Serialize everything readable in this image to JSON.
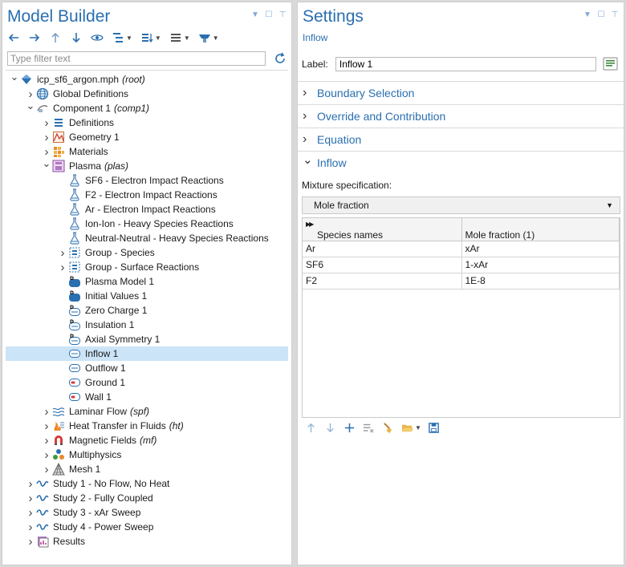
{
  "model_builder": {
    "title": "Model Builder",
    "filter_placeholder": "Type filter text",
    "tree": [
      {
        "depth": 0,
        "expand": "open",
        "icon": "model-icon",
        "label": "icp_sf6_argon.mph",
        "tag": "(root)"
      },
      {
        "depth": 1,
        "expand": "closed",
        "icon": "globe-icon",
        "label": "Global Definitions",
        "tag": ""
      },
      {
        "depth": 1,
        "expand": "open",
        "icon": "component-icon",
        "label": "Component 1",
        "tag": "(comp1)"
      },
      {
        "depth": 2,
        "expand": "closed",
        "icon": "definitions-icon",
        "label": "Definitions",
        "tag": ""
      },
      {
        "depth": 2,
        "expand": "closed",
        "icon": "geometry-icon",
        "label": "Geometry 1",
        "tag": ""
      },
      {
        "depth": 2,
        "expand": "closed",
        "icon": "materials-icon",
        "label": "Materials",
        "tag": ""
      },
      {
        "depth": 2,
        "expand": "open",
        "icon": "plasma-icon",
        "label": "Plasma",
        "tag": "(plas)"
      },
      {
        "depth": 3,
        "expand": "none",
        "icon": "reaction-icon",
        "label": "SF6 - Electron Impact Reactions",
        "tag": ""
      },
      {
        "depth": 3,
        "expand": "none",
        "icon": "reaction-icon",
        "label": "F2 - Electron Impact Reactions",
        "tag": ""
      },
      {
        "depth": 3,
        "expand": "none",
        "icon": "reaction-icon",
        "label": "Ar - Electron Impact Reactions",
        "tag": ""
      },
      {
        "depth": 3,
        "expand": "none",
        "icon": "reaction-icon",
        "label": "Ion-Ion - Heavy Species Reactions",
        "tag": ""
      },
      {
        "depth": 3,
        "expand": "none",
        "icon": "reaction-icon",
        "label": "Neutral-Neutral - Heavy Species Reactions",
        "tag": ""
      },
      {
        "depth": 3,
        "expand": "closed",
        "icon": "group-icon",
        "label": "Group - Species",
        "tag": ""
      },
      {
        "depth": 3,
        "expand": "closed",
        "icon": "group-icon",
        "label": "Group - Surface Reactions",
        "tag": ""
      },
      {
        "depth": 3,
        "expand": "none",
        "icon": "domain-node-icon",
        "label": "Plasma Model 1",
        "tag": ""
      },
      {
        "depth": 3,
        "expand": "none",
        "icon": "domain-node-icon",
        "label": "Initial Values 1",
        "tag": ""
      },
      {
        "depth": 3,
        "expand": "none",
        "icon": "boundary-default-icon",
        "label": "Zero Charge 1",
        "tag": ""
      },
      {
        "depth": 3,
        "expand": "none",
        "icon": "boundary-default-icon",
        "label": "Insulation 1",
        "tag": ""
      },
      {
        "depth": 3,
        "expand": "none",
        "icon": "boundary-default-icon",
        "label": "Axial Symmetry 1",
        "tag": ""
      },
      {
        "depth": 3,
        "expand": "none",
        "icon": "boundary-icon",
        "label": "Inflow 1",
        "tag": "",
        "selected": true
      },
      {
        "depth": 3,
        "expand": "none",
        "icon": "boundary-icon",
        "label": "Outflow 1",
        "tag": ""
      },
      {
        "depth": 3,
        "expand": "none",
        "icon": "boundary-red-icon",
        "label": "Ground 1",
        "tag": ""
      },
      {
        "depth": 3,
        "expand": "none",
        "icon": "boundary-red-icon",
        "label": "Wall 1",
        "tag": ""
      },
      {
        "depth": 2,
        "expand": "closed",
        "icon": "laminar-flow-icon",
        "label": "Laminar Flow",
        "tag": "(spf)"
      },
      {
        "depth": 2,
        "expand": "closed",
        "icon": "heat-transfer-icon",
        "label": "Heat Transfer in Fluids",
        "tag": "(ht)"
      },
      {
        "depth": 2,
        "expand": "closed",
        "icon": "magnet-icon",
        "label": "Magnetic Fields",
        "tag": "(mf)"
      },
      {
        "depth": 2,
        "expand": "closed",
        "icon": "multiphysics-icon",
        "label": "Multiphysics",
        "tag": ""
      },
      {
        "depth": 2,
        "expand": "closed",
        "icon": "mesh-icon",
        "label": "Mesh 1",
        "tag": ""
      },
      {
        "depth": 1,
        "expand": "closed",
        "icon": "study-icon",
        "label": "Study 1 - No Flow, No Heat",
        "tag": ""
      },
      {
        "depth": 1,
        "expand": "closed",
        "icon": "study-icon",
        "label": "Study 2 - Fully Coupled",
        "tag": ""
      },
      {
        "depth": 1,
        "expand": "closed",
        "icon": "study-icon",
        "label": "Study 3 - xAr Sweep",
        "tag": ""
      },
      {
        "depth": 1,
        "expand": "closed",
        "icon": "study-icon",
        "label": "Study 4 - Power Sweep",
        "tag": ""
      },
      {
        "depth": 1,
        "expand": "closed",
        "icon": "results-icon",
        "label": "Results",
        "tag": ""
      }
    ]
  },
  "settings": {
    "title": "Settings",
    "subtitle": "Inflow",
    "label_caption": "Label:",
    "label_value": "Inflow 1",
    "sections": [
      {
        "label": "Boundary Selection",
        "state": "collapsed"
      },
      {
        "label": "Override and Contribution",
        "state": "collapsed"
      },
      {
        "label": "Equation",
        "state": "collapsed"
      },
      {
        "label": "Inflow",
        "state": "expanded"
      }
    ],
    "mixture_label": "Mixture specification:",
    "mixture_value": "Mole fraction",
    "table": {
      "headers": [
        "Species names",
        "Mole fraction (1)"
      ],
      "rows": [
        [
          "Ar",
          "xAr"
        ],
        [
          "SF6",
          "1-xAr"
        ],
        [
          "F2",
          "1E-8"
        ]
      ]
    }
  },
  "colors": {
    "accent": "#2a6fb0",
    "selection": "#cce4f7"
  }
}
